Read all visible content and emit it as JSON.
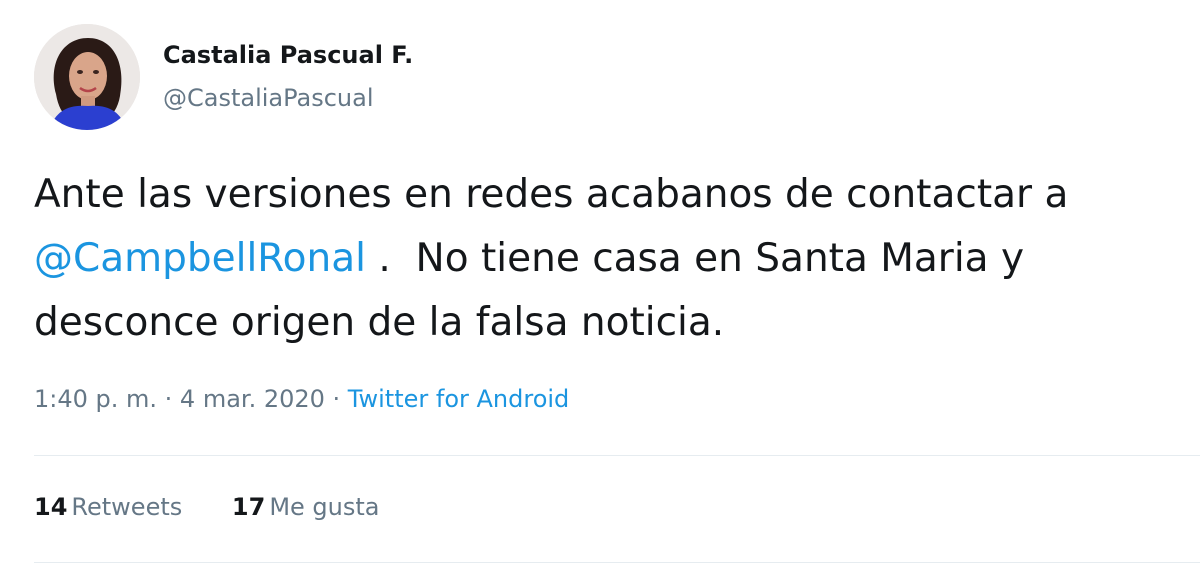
{
  "author": {
    "display_name": "Castalia Pascual F.",
    "handle": "@CastaliaPascual",
    "avatar_icon": "profile-photo"
  },
  "tweet": {
    "line1": "Ante las versiones en redes acabanos de contactar a",
    "mention": "@CampbellRonal",
    "line2_rest": " .  No tiene casa en Santa Maria y",
    "line3": "desconce origen de la falsa noticia."
  },
  "meta": {
    "time": "1:40 p. m.",
    "separator1": " · ",
    "date": "4 mar. 2020",
    "separator2": " · ",
    "source": "Twitter for Android"
  },
  "stats": {
    "retweets_count": "14",
    "retweets_label": "Retweets",
    "likes_count": "17",
    "likes_label": "Me gusta"
  },
  "colors": {
    "link": "#1b95e0",
    "secondary_text": "#657786",
    "primary_text": "#14171a",
    "divider": "#e6ecf0"
  }
}
